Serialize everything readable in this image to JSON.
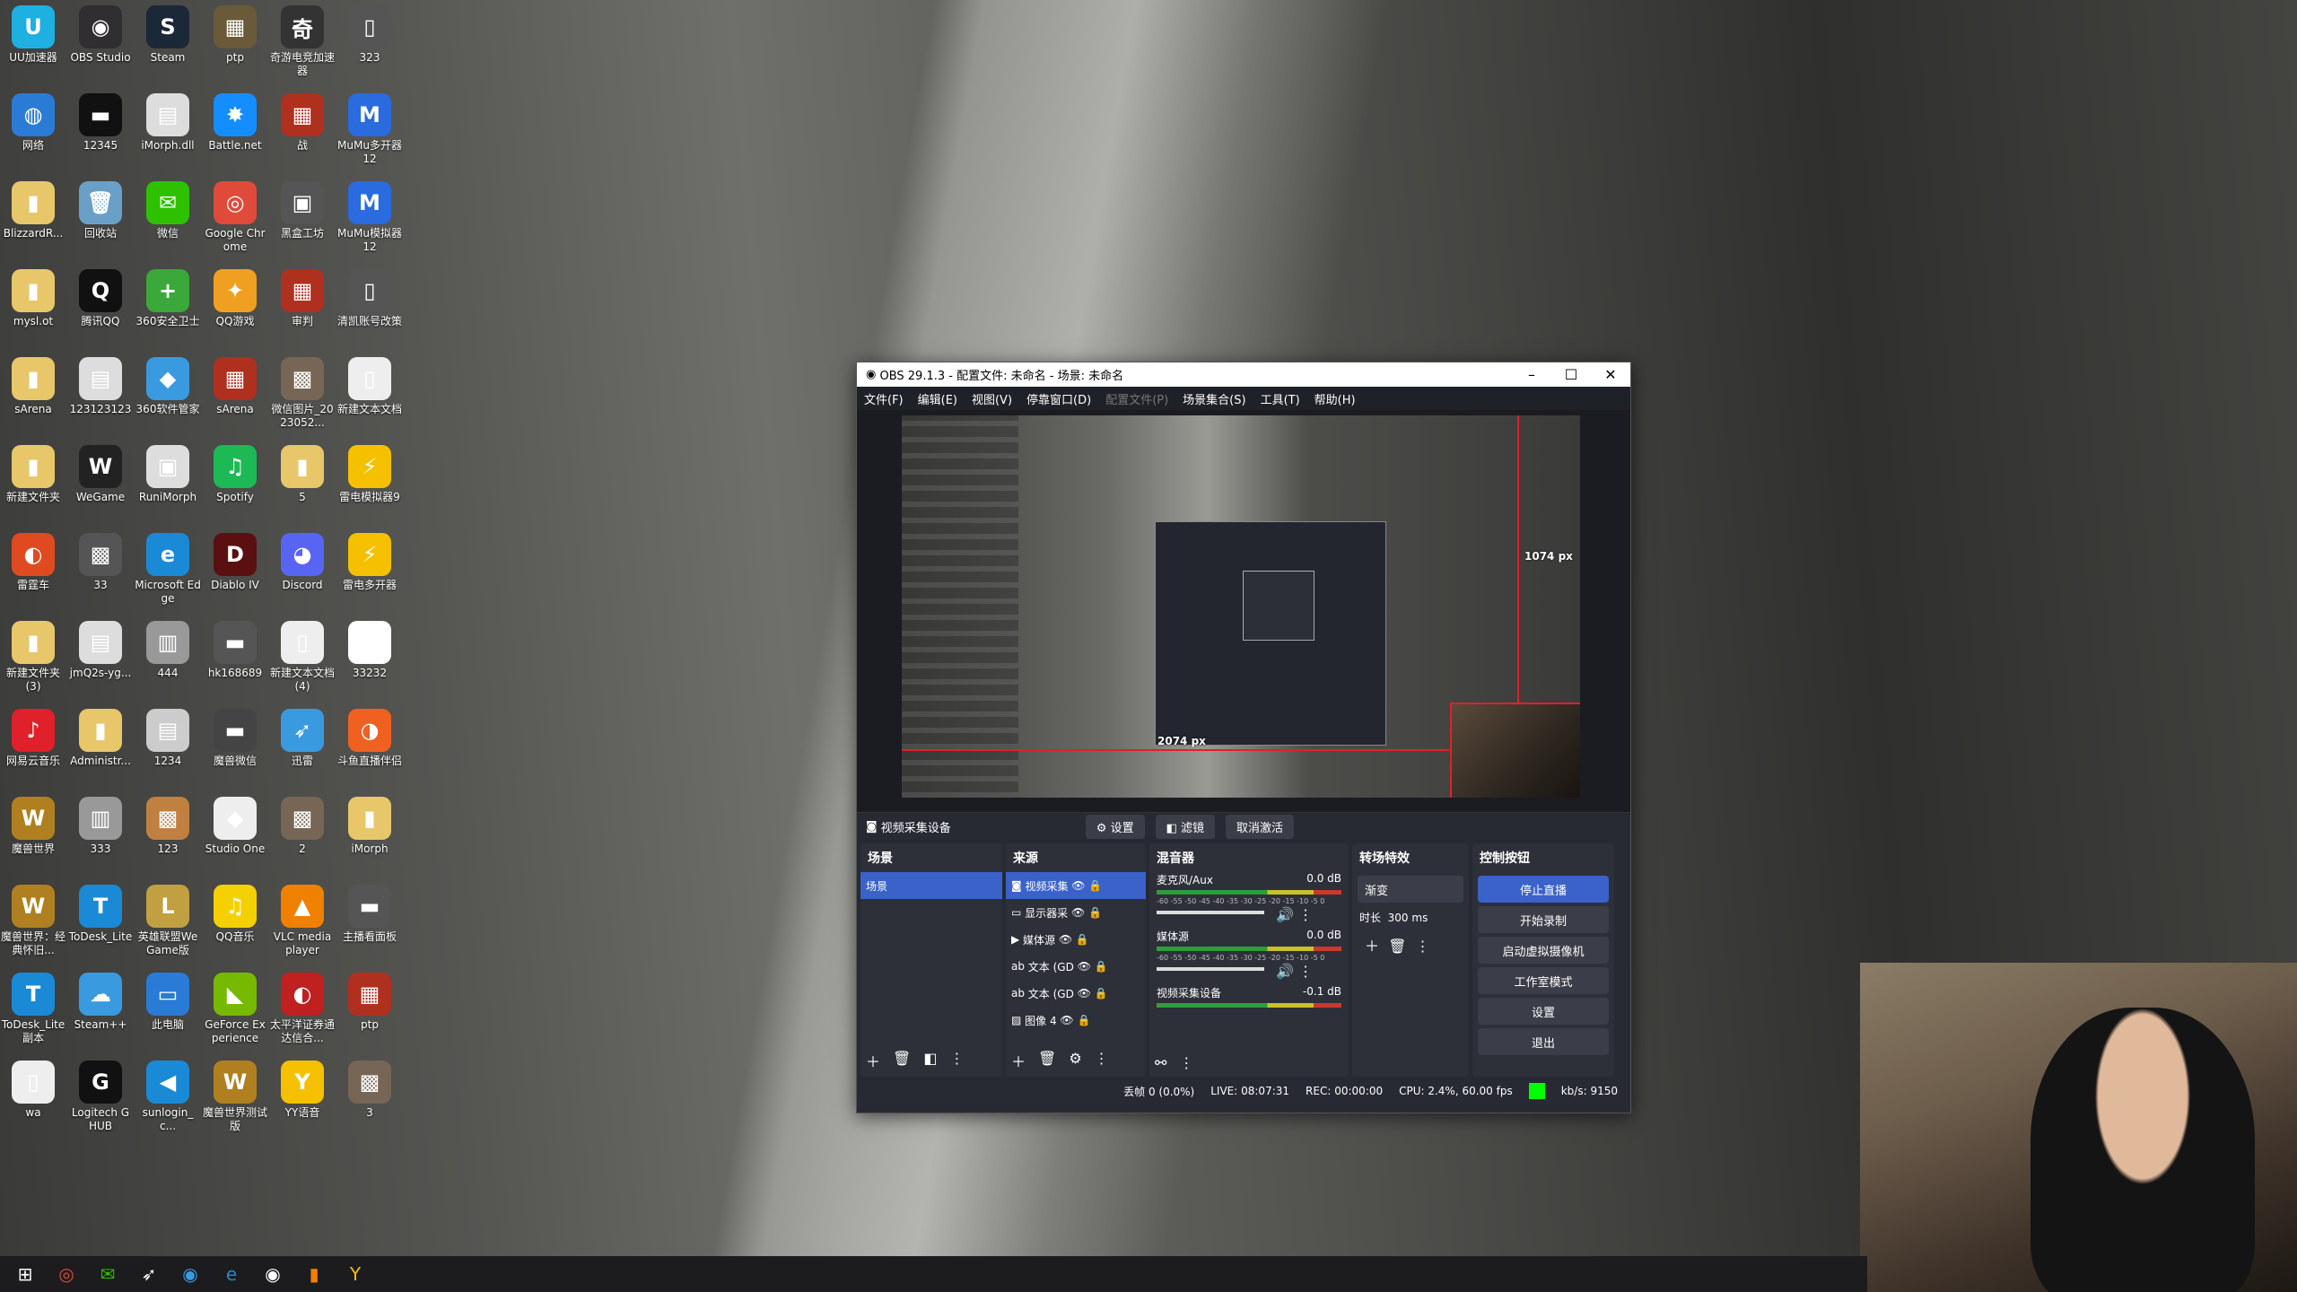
{
  "desktop": {
    "icons": [
      {
        "label": "UU加速器",
        "glyph": "U",
        "color": "#1db0e0"
      },
      {
        "label": "OBS Studio",
        "glyph": "◉",
        "color": "#302e31"
      },
      {
        "label": "Steam",
        "glyph": "S",
        "color": "#1b2838"
      },
      {
        "label": "ptp",
        "glyph": "▦",
        "color": "#6a5a3a"
      },
      {
        "label": "奇游电竞加速器",
        "glyph": "奇",
        "color": "#333"
      },
      {
        "label": "323",
        "glyph": "▯",
        "color": "#555"
      },
      {
        "label": "网络",
        "glyph": "◍",
        "color": "#2a7bd6"
      },
      {
        "label": "12345",
        "glyph": "▬",
        "color": "#111"
      },
      {
        "label": "iMorph.dll",
        "glyph": "▤",
        "color": "#ddd"
      },
      {
        "label": "Battle.net",
        "glyph": "✸",
        "color": "#148eff"
      },
      {
        "label": "战",
        "glyph": "▦",
        "color": "#b03020"
      },
      {
        "label": "MuMu多开器12",
        "glyph": "M",
        "color": "#2a6be0"
      },
      {
        "label": "BlizzardR...",
        "glyph": "▮",
        "color": "#e8c66a"
      },
      {
        "label": "回收站",
        "glyph": "🗑",
        "color": "#6aa0c8"
      },
      {
        "label": "微信",
        "glyph": "✉",
        "color": "#2dc100"
      },
      {
        "label": "Google Chrome",
        "glyph": "◎",
        "color": "#e04a3a"
      },
      {
        "label": "黑盒工坊",
        "glyph": "▣",
        "color": "#555"
      },
      {
        "label": "MuMu模拟器12",
        "glyph": "M",
        "color": "#2a6be0"
      },
      {
        "label": "mysl.ot",
        "glyph": "▮",
        "color": "#e8c66a"
      },
      {
        "label": "腾讯QQ",
        "glyph": "Q",
        "color": "#111"
      },
      {
        "label": "360安全卫士",
        "glyph": "+",
        "color": "#3aa83a"
      },
      {
        "label": "QQ游戏",
        "glyph": "✦",
        "color": "#f0a020"
      },
      {
        "label": "审判",
        "glyph": "▦",
        "color": "#b03020"
      },
      {
        "label": "清凯账号改策",
        "glyph": "▯",
        "color": "#555"
      },
      {
        "label": "sArena",
        "glyph": "▮",
        "color": "#e8c66a"
      },
      {
        "label": "123123123",
        "glyph": "▤",
        "color": "#ddd"
      },
      {
        "label": "360软件管家",
        "glyph": "◆",
        "color": "#3a9ae0"
      },
      {
        "label": "sArena",
        "glyph": "▦",
        "color": "#b03020"
      },
      {
        "label": "微信图片_2023052...",
        "glyph": "▩",
        "color": "#776655"
      },
      {
        "label": "新建文本文档",
        "glyph": "▯",
        "color": "#eee"
      },
      {
        "label": "新建文件夹",
        "glyph": "▮",
        "color": "#e8c66a"
      },
      {
        "label": "WeGame",
        "glyph": "W",
        "color": "#222"
      },
      {
        "label": "RuniMorph",
        "glyph": "▣",
        "color": "#ddd"
      },
      {
        "label": "Spotify",
        "glyph": "♫",
        "color": "#1db954"
      },
      {
        "label": "5",
        "glyph": "▮",
        "color": "#e8c66a"
      },
      {
        "label": "雷电模拟器9",
        "glyph": "⚡",
        "color": "#f5c000"
      },
      {
        "label": "雷霆车",
        "glyph": "◐",
        "color": "#e04a20"
      },
      {
        "label": "33",
        "glyph": "▩",
        "color": "#555"
      },
      {
        "label": "Microsoft Edge",
        "glyph": "e",
        "color": "#1a8ad6"
      },
      {
        "label": "Diablo IV",
        "glyph": "D",
        "color": "#5a1010"
      },
      {
        "label": "Discord",
        "glyph": "◕",
        "color": "#5865f2"
      },
      {
        "label": "雷电多开器",
        "glyph": "⚡",
        "color": "#f5c000"
      },
      {
        "label": "新建文件夹(3)",
        "glyph": "▮",
        "color": "#e8c66a"
      },
      {
        "label": "jmQ2s-yg...",
        "glyph": "▤",
        "color": "#ddd"
      },
      {
        "label": "444",
        "glyph": "▥",
        "color": "#999"
      },
      {
        "label": "hk168689",
        "glyph": "▬",
        "color": "#555"
      },
      {
        "label": "新建文本文档(4)",
        "glyph": "▯",
        "color": "#eee"
      },
      {
        "label": "33232",
        "glyph": "▭",
        "color": "#fff"
      },
      {
        "label": "网易云音乐",
        "glyph": "♪",
        "color": "#e0202a"
      },
      {
        "label": "Administr...",
        "glyph": "▮",
        "color": "#e8c66a"
      },
      {
        "label": "1234",
        "glyph": "▤",
        "color": "#ccc"
      },
      {
        "label": "魔兽微信",
        "glyph": "▬",
        "color": "#444"
      },
      {
        "label": "迅雷",
        "glyph": "➶",
        "color": "#3a9ae0"
      },
      {
        "label": "斗鱼直播伴侣",
        "glyph": "◑",
        "color": "#f06020"
      },
      {
        "label": "魔兽世界",
        "glyph": "W",
        "color": "#b08020"
      },
      {
        "label": "333",
        "glyph": "▥",
        "color": "#999"
      },
      {
        "label": "123",
        "glyph": "▩",
        "color": "#c08040"
      },
      {
        "label": "Studio One",
        "glyph": "◆",
        "color": "#eee"
      },
      {
        "label": "2",
        "glyph": "▩",
        "color": "#776655"
      },
      {
        "label": "iMorph",
        "glyph": "▮",
        "color": "#e8c66a"
      },
      {
        "label": "魔兽世界：经典怀旧...",
        "glyph": "W",
        "color": "#b08020"
      },
      {
        "label": "ToDesk_Lite",
        "glyph": "T",
        "color": "#1a8ad6"
      },
      {
        "label": "英雄联盟WeGame版",
        "glyph": "L",
        "color": "#c0a040"
      },
      {
        "label": "QQ音乐",
        "glyph": "♫",
        "color": "#f5d000"
      },
      {
        "label": "VLC media player",
        "glyph": "▲",
        "color": "#f08000"
      },
      {
        "label": "主播看面板",
        "glyph": "▬",
        "color": "#555"
      },
      {
        "label": "ToDesk_Lite副本",
        "glyph": "T",
        "color": "#1a8ad6"
      },
      {
        "label": "Steam++",
        "glyph": "☁",
        "color": "#3a9ae0"
      },
      {
        "label": "此电脑",
        "glyph": "▭",
        "color": "#2a7bd6"
      },
      {
        "label": "GeForce Experience",
        "glyph": "◣",
        "color": "#76b900"
      },
      {
        "label": "太平洋证券通达信合...",
        "glyph": "◐",
        "color": "#c02020"
      },
      {
        "label": "ptp",
        "glyph": "▦",
        "color": "#b03020"
      },
      {
        "label": "wa",
        "glyph": "▯",
        "color": "#eee"
      },
      {
        "label": "Logitech G HUB",
        "glyph": "G",
        "color": "#111"
      },
      {
        "label": "sunlogin_c...",
        "glyph": "◀",
        "color": "#1a8ad6"
      },
      {
        "label": "魔兽世界测试版",
        "glyph": "W",
        "color": "#b08020"
      },
      {
        "label": "YY语音",
        "glyph": "Y",
        "color": "#f5c000"
      },
      {
        "label": "3",
        "glyph": "▩",
        "color": "#776655"
      }
    ]
  },
  "obs": {
    "title": "OBS 29.1.3 - 配置文件: 未命名 - 场景: 未命名",
    "menu": [
      "文件(F)",
      "编辑(E)",
      "视图(V)",
      "停靠窗口(D)",
      "配置文件(P)",
      "场景集合(S)",
      "工具(T)",
      "帮助(H)"
    ],
    "preview": {
      "label_v": "1074 px",
      "label_h": "2074 px"
    },
    "source_bar": {
      "source_name": "视频采集设备",
      "settings": "设置",
      "filters": "滤镜",
      "deactivate": "取消激活"
    },
    "scenes": {
      "title": "场景",
      "items": [
        "场景"
      ]
    },
    "sources": {
      "title": "来源",
      "items": [
        "视频采集",
        "显示器采",
        "媒体源",
        "文本 (GD",
        "文本 (GD",
        "图像 4"
      ]
    },
    "mixer": {
      "title": "混音器",
      "channels": [
        {
          "name": "麦克风/Aux",
          "db": "0.0 dB"
        },
        {
          "name": "媒体源",
          "db": "0.0 dB"
        },
        {
          "name": "视频采集设备",
          "db": "-0.1 dB"
        }
      ],
      "scale": "-60 -55 -50 -45 -40 -35 -30 -25 -20 -15 -10 -5 0"
    },
    "transitions": {
      "title": "转场特效",
      "type": "渐变",
      "duration_label": "时长",
      "duration": "300 ms"
    },
    "controls": {
      "title": "控制按钮",
      "buttons": [
        "停止直播",
        "开始录制",
        "启动虚拟摄像机",
        "工作室模式",
        "设置",
        "退出"
      ]
    },
    "status": {
      "dropped": "丢帧 0 (0.0%)",
      "live": "LIVE: 08:07:31",
      "rec": "REC: 00:00:00",
      "cpu": "CPU: 2.4%, 60.00 fps",
      "kbs": "kb/s: 9150"
    }
  },
  "taskbar": {
    "icons": [
      "windows-start",
      "chrome",
      "wechat",
      "send",
      "360",
      "edge",
      "obs",
      "app",
      "yy"
    ]
  }
}
